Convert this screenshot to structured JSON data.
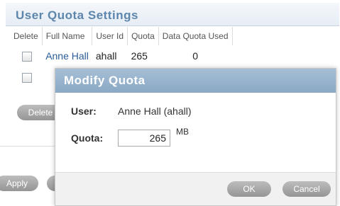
{
  "panel": {
    "title": "User Quota Settings"
  },
  "table": {
    "headers": [
      "Delete",
      "Full Name",
      "User Id",
      "Quota",
      "Data Quota Used"
    ],
    "rows": [
      {
        "full_name": "Anne Hall",
        "user_id": "ahall",
        "quota": "265",
        "used": "0"
      }
    ]
  },
  "buttons": {
    "delete": "Delete",
    "apply": "Apply"
  },
  "dialog": {
    "title": "Modify Quota",
    "user_label": "User:",
    "user_value": "Anne Hall (ahall)",
    "quota_label": "Quota:",
    "quota_value": "265",
    "quota_unit": "MB",
    "ok": "OK",
    "cancel": "Cancel"
  }
}
